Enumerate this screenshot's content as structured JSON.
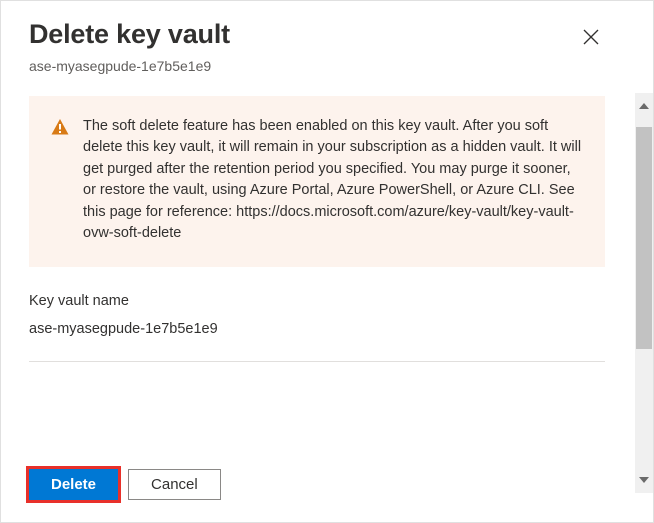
{
  "header": {
    "title": "Delete key vault",
    "subtitle": "ase-myasegpude-1e7b5e1e9"
  },
  "warning": {
    "message": "The soft delete feature has been enabled on this key vault. After you soft delete this key vault, it will remain in your subscription as a hidden vault. It will get purged after the retention period you specified. You may purge it sooner, or restore the vault, using Azure Portal, Azure PowerShell, or Azure CLI. See this page for reference: https://docs.microsoft.com/azure/key-vault/key-vault-ovw-soft-delete"
  },
  "field": {
    "label": "Key vault name",
    "value": "ase-myasegpude-1e7b5e1e9"
  },
  "buttons": {
    "delete": "Delete",
    "cancel": "Cancel"
  }
}
